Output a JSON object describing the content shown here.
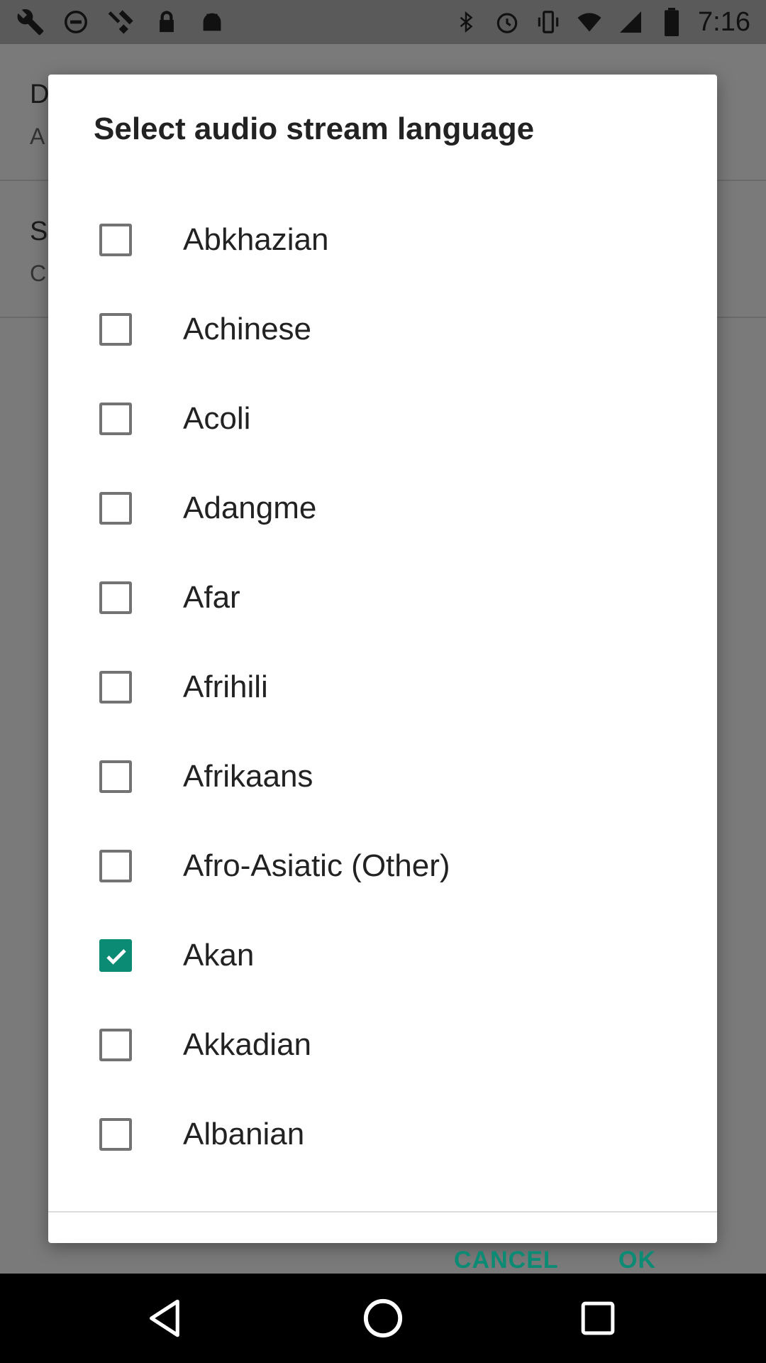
{
  "status_bar": {
    "time": "7:16",
    "icons_left": [
      "wrench-icon",
      "blocked-icon",
      "fake-gps-icon",
      "lock-icon",
      "android-icon"
    ],
    "icons_right": [
      "bluetooth-icon",
      "alarm-icon",
      "vibrate-icon",
      "wifi-icon",
      "signal-icon",
      "battery-icon"
    ]
  },
  "background": {
    "item1_title": "D",
    "item1_sub": "A",
    "item2_title": "S",
    "item2_sub": "C"
  },
  "dialog": {
    "title": "Select audio stream language",
    "items": [
      {
        "label": "Abkhazian",
        "checked": false
      },
      {
        "label": "Achinese",
        "checked": false
      },
      {
        "label": "Acoli",
        "checked": false
      },
      {
        "label": "Adangme",
        "checked": false
      },
      {
        "label": "Afar",
        "checked": false
      },
      {
        "label": "Afrihili",
        "checked": false
      },
      {
        "label": "Afrikaans",
        "checked": false
      },
      {
        "label": "Afro-Asiatic (Other)",
        "checked": false
      },
      {
        "label": "Akan",
        "checked": true
      },
      {
        "label": "Akkadian",
        "checked": false
      },
      {
        "label": "Albanian",
        "checked": false
      }
    ],
    "cancel_label": "CANCEL",
    "ok_label": "OK"
  },
  "colors": {
    "accent": "#0b8a74",
    "scrim": "#7a7a7a"
  }
}
